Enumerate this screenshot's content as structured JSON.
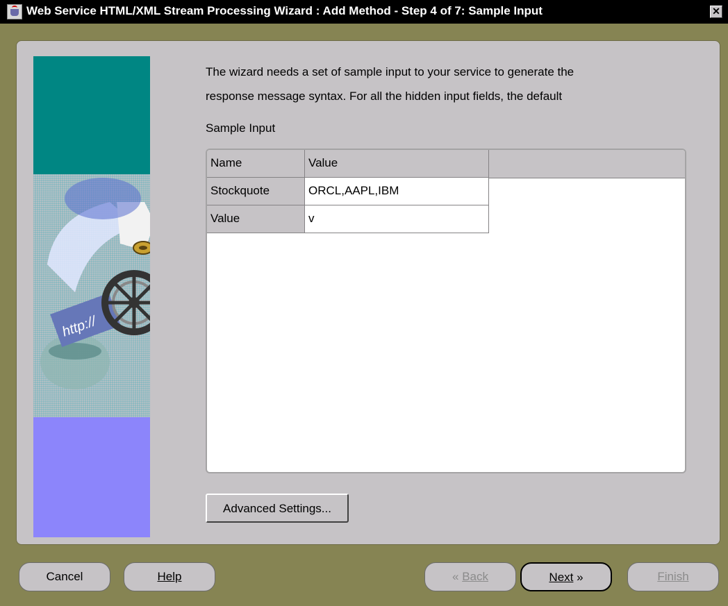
{
  "window": {
    "title": "Web Service HTML/XML Stream Processing Wizard : Add Method - Step 4 of 7: Sample Input",
    "close_glyph": "✕"
  },
  "intro": {
    "line1": "The wizard needs a set of sample input to your service to generate the",
    "line2": "response message syntax. For all the hidden input fields, the default"
  },
  "section_label": "Sample Input",
  "table": {
    "headers": [
      "Name",
      "Value"
    ],
    "rows": [
      {
        "name": "Stockquote",
        "value": "ORCL,AAPL,IBM"
      },
      {
        "name": "Value",
        "value": "v"
      }
    ]
  },
  "buttons": {
    "advanced": "Advanced Settings...",
    "cancel": "Cancel",
    "help": "Help",
    "back": "Back",
    "next": "Next",
    "finish": "Finish"
  },
  "icons": {
    "back": "chevron-left-double-icon",
    "next": "chevron-right-double-icon",
    "app": "java-cup-icon"
  },
  "colors": {
    "background": "#868453",
    "panel": "#c6c3c6",
    "titlebar": "#000000",
    "teal": "#008683",
    "lavender": "#8c85fb"
  }
}
